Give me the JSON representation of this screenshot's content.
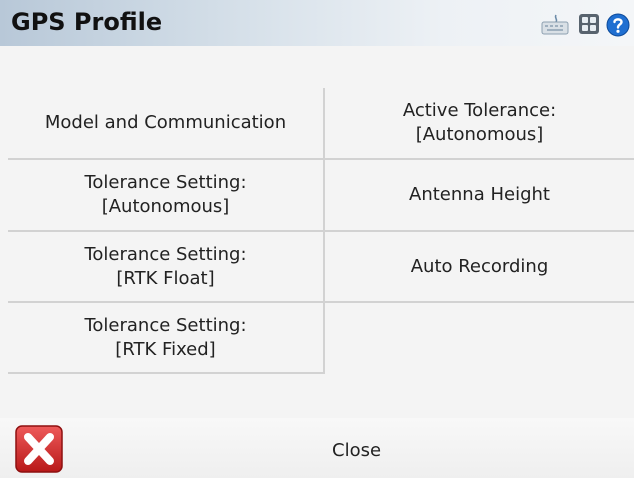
{
  "window": {
    "title": "GPS Profile"
  },
  "titlebar_icons": [
    "keyboard-icon",
    "grid-icon",
    "help-icon"
  ],
  "menu": {
    "items": [
      {
        "lines": [
          "Model and Communication"
        ]
      },
      {
        "lines": [
          "Active Tolerance:",
          "[Autonomous]"
        ]
      },
      {
        "lines": [
          "Tolerance Setting:",
          "[Autonomous]"
        ]
      },
      {
        "lines": [
          "Antenna Height"
        ]
      },
      {
        "lines": [
          "Tolerance Setting:",
          "[RTK Float]"
        ]
      },
      {
        "lines": [
          "Auto Recording"
        ]
      },
      {
        "lines": [
          "Tolerance Setting:",
          "[RTK Fixed]"
        ]
      }
    ]
  },
  "footer": {
    "close_label": "Close"
  },
  "colors": {
    "close_red": "#d9272e",
    "help_blue": "#1f6fd1"
  }
}
